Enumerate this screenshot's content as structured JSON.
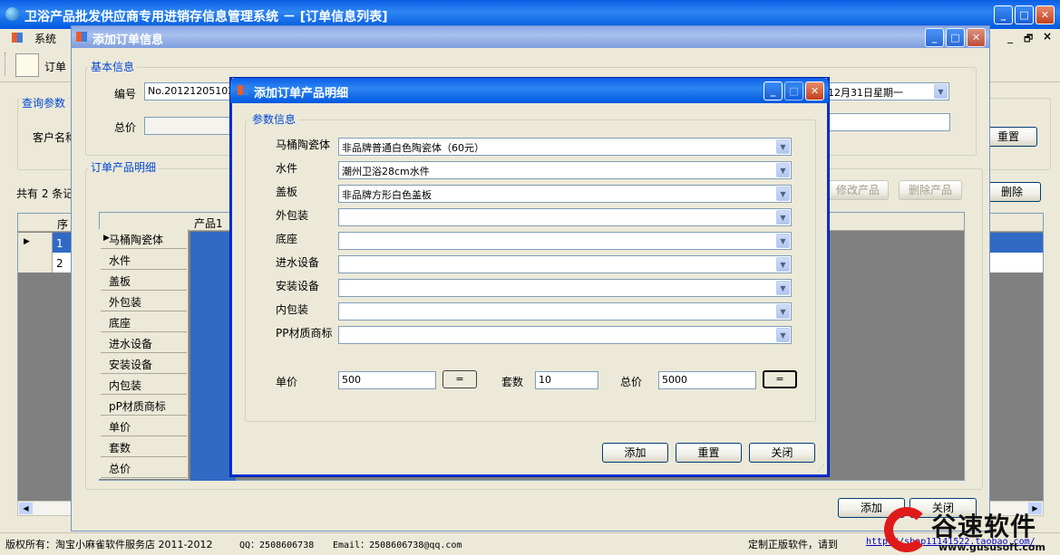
{
  "main_window": {
    "title": "卫浴产品批发供应商专用进销存信息管理系统 － [订单信息列表]"
  },
  "menu": {
    "system": "系统"
  },
  "toolbar": {
    "order_label": "订单"
  },
  "list_page": {
    "query_params": "查询参数",
    "customer_name": "客户名称",
    "reset": "重置",
    "record_count": "共有 2 条记",
    "delete": "删除",
    "col_seq": "序",
    "rows": [
      "1",
      "2"
    ]
  },
  "add_order": {
    "title": "添加订单信息",
    "basic_info": "基本信息",
    "number_label": "编号",
    "number_value": "No.2012120510227",
    "total_label": "总价",
    "date_value": "12月31日星期一",
    "detail_group": "订单产品明细",
    "edit_product": "修改产品",
    "delete_product": "删除产品",
    "col_product1": "产品1",
    "row_headers": [
      "马桶陶瓷体",
      "水件",
      "盖板",
      "外包装",
      "底座",
      "进水设备",
      "安装设备",
      "内包装",
      "pP材质商标",
      "单价",
      "套数",
      "总价"
    ],
    "add": "添加",
    "close": "关闭"
  },
  "dialog": {
    "title": "添加订单产品明细",
    "group": "参数信息",
    "fields": [
      {
        "label": "马桶陶瓷体",
        "value": "非品牌普通白色陶瓷体（60元）"
      },
      {
        "label": "水件",
        "value": "潮州卫浴28cm水件"
      },
      {
        "label": "盖板",
        "value": "非品牌方形白色盖板"
      },
      {
        "label": "外包装",
        "value": ""
      },
      {
        "label": "底座",
        "value": ""
      },
      {
        "label": "进水设备",
        "value": ""
      },
      {
        "label": "安装设备",
        "value": ""
      },
      {
        "label": "内包装",
        "value": ""
      },
      {
        "label": "PP材质商标",
        "value": ""
      }
    ],
    "unit_price_label": "单价",
    "unit_price": "500",
    "eq1": "=",
    "sets_label": "套数",
    "sets": "10",
    "total_label": "总价",
    "total": "5000",
    "eq2": "=",
    "add": "添加",
    "reset": "重置",
    "close": "关闭"
  },
  "status": {
    "copyright": "版权所有：淘宝小麻雀软件服务店 2011-2012",
    "qq": "QQ：2508606738",
    "email": "Email：2508606738@qq.com",
    "genuine": "定制正版软件，请到",
    "url": "http://shop11141522.taobao.com/"
  },
  "watermark": {
    "brand": "谷速软件",
    "url": "www.gususoft.com"
  }
}
